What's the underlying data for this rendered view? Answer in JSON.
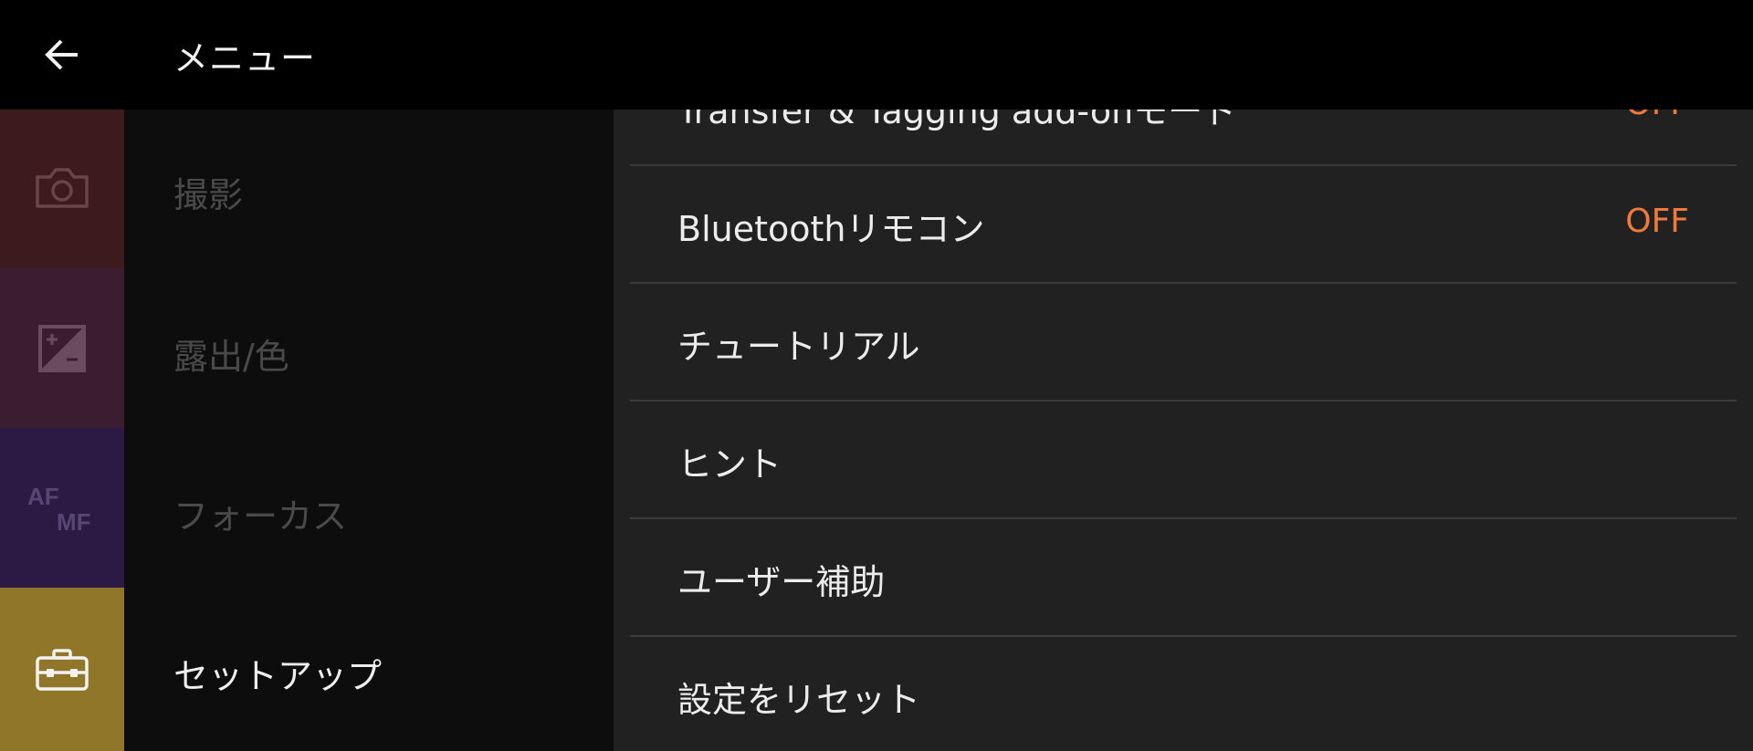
{
  "header": {
    "title": "メニュー",
    "back_icon": "arrow-left-icon"
  },
  "categories": [
    {
      "label": "撮影",
      "icon": "camera-icon",
      "color": "#3d1a1e",
      "active": false
    },
    {
      "label": "露出/色",
      "icon": "exposure-compensation-icon",
      "color": "#3a1e2f",
      "active": false
    },
    {
      "label": "フォーカス",
      "icon": "af-mf-icon",
      "icon_text_top": "AF",
      "icon_text_bottom": "MF",
      "color": "#2c1a45",
      "active": false
    },
    {
      "label": "セットアップ",
      "icon": "toolbox-icon",
      "color": "#8f7628",
      "active": true
    }
  ],
  "settings": [
    {
      "label": "Transfer & Tagging add-onモード",
      "value": "OFF"
    },
    {
      "label": "Bluetoothリモコン",
      "value": "OFF"
    },
    {
      "label": "チュートリアル",
      "value": ""
    },
    {
      "label": "ヒント",
      "value": ""
    },
    {
      "label": "ユーザー補助",
      "value": ""
    },
    {
      "label": "設定をリセット",
      "value": ""
    }
  ],
  "colors": {
    "accent_value": "#f07a3c",
    "background": "#212121"
  }
}
